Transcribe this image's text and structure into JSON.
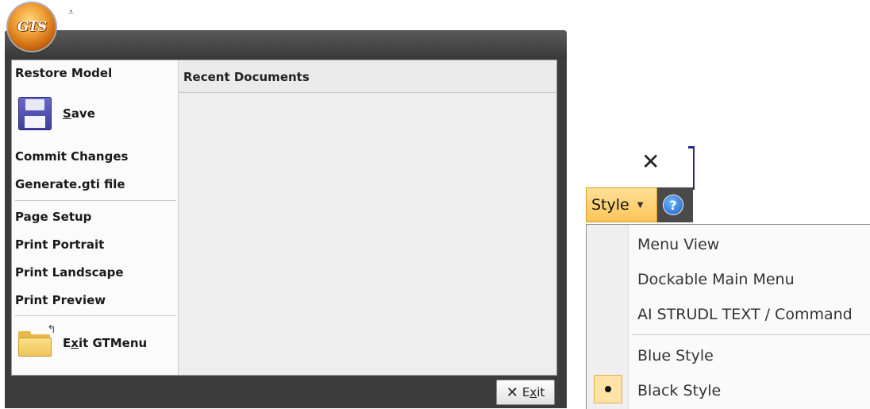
{
  "app": {
    "logo_text": "GTS",
    "qat_glyph": "⩡"
  },
  "backstage": {
    "items": [
      {
        "label": "Restore Model"
      },
      {
        "label": "Save",
        "access_key": "S",
        "rest": "ave"
      },
      {
        "label": "Commit Changes"
      },
      {
        "label": "Generate.gti file"
      },
      {
        "label": "Page Setup"
      },
      {
        "label": "Print Portrait"
      },
      {
        "label": "Print Landscape"
      },
      {
        "label": "Print Preview"
      },
      {
        "label": "Exit GTMenu",
        "pre": "E",
        "access_key": "x",
        "rest": "it GTMenu"
      }
    ],
    "recent_header": "Recent Documents",
    "exit_button": {
      "pre": "E",
      "access_key": "x",
      "rest": "it"
    }
  },
  "style_menu": {
    "close_glyph": "✕",
    "button_label": "Style",
    "help_glyph": "?",
    "items": [
      {
        "label": "Menu View"
      },
      {
        "label": "Dockable Main Menu"
      },
      {
        "label": "AI STRUDL TEXT / Command"
      },
      {
        "label": "Blue Style"
      },
      {
        "label": "Black Style",
        "selected": true
      }
    ]
  },
  "icons": [
    "floppy-disk-icon",
    "folder-exit-icon",
    "close-icon",
    "help-icon",
    "dropdown-caret-icon",
    "radio-dot-icon"
  ],
  "colors": {
    "accent": "#ffc65a",
    "frame": "#3c3c3c",
    "help_blue": "#1b5fc7"
  }
}
